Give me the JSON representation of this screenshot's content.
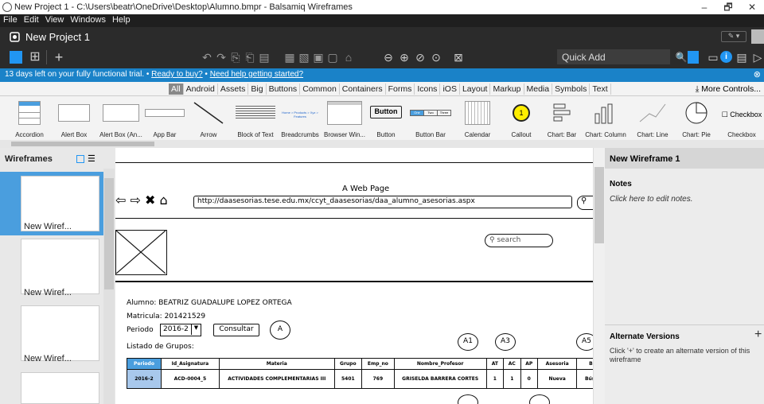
{
  "window": {
    "title": "New Project 1 - C:\\Users\\beatr\\OneDrive\\Desktop\\Alumno.bmpr - Balsamiq Wireframes",
    "min": "–",
    "max": "🗗",
    "close": "✕"
  },
  "menu": [
    "File",
    "Edit",
    "View",
    "Windows",
    "Help"
  ],
  "project": {
    "name": "New Project 1"
  },
  "quick_add": "Quick Add",
  "trial": {
    "text": "13 days left on your fully functional trial.  •  ",
    "buy": "Ready to buy?",
    "sep": "  •  ",
    "help": "Need help getting started?"
  },
  "categories": [
    "All",
    "Android",
    "Assets",
    "Big",
    "Buttons",
    "Common",
    "Containers",
    "Forms",
    "Icons",
    "iOS",
    "Layout",
    "Markup",
    "Media",
    "Symbols",
    "Text"
  ],
  "more_controls": "More Controls...",
  "components": [
    {
      "name": "Accordion",
      "label": "Accordion"
    },
    {
      "name": "alert-box",
      "label": "Alert Box"
    },
    {
      "name": "alert-box-an",
      "label": "Alert Box (An..."
    },
    {
      "name": "app-bar",
      "label": "App Bar"
    },
    {
      "name": "arrow",
      "label": "Arrow"
    },
    {
      "name": "block-of-text",
      "label": "Block of Text"
    },
    {
      "name": "breadcrumbs",
      "label": "Breadcrumbs",
      "sample": "Home > Products > Xyz > Features"
    },
    {
      "name": "browser-window",
      "label": "Browser Win..."
    },
    {
      "name": "button",
      "label": "Button",
      "sample": "Button"
    },
    {
      "name": "button-bar",
      "label": "Button Bar",
      "sample": [
        "One",
        "Two",
        "Three"
      ]
    },
    {
      "name": "calendar",
      "label": "Calendar"
    },
    {
      "name": "callout",
      "label": "Callout",
      "sample": "1"
    },
    {
      "name": "chart-bar",
      "label": "Chart: Bar"
    },
    {
      "name": "chart-column",
      "label": "Chart: Column"
    },
    {
      "name": "chart-line",
      "label": "Chart: Line"
    },
    {
      "name": "chart-pie",
      "label": "Chart: Pie"
    },
    {
      "name": "checkbox",
      "label": "Checkbox",
      "sample": "Checkbox"
    }
  ],
  "sidebar": {
    "title": "Wireframes",
    "thumbs": [
      "New Wiref...",
      "New Wiref...",
      "New Wiref..."
    ]
  },
  "wireframe": {
    "browser_title": "A Web Page",
    "url": "http://daasesorias.tese.edu.mx/ccyt_daasesorias/daa_alumno_asesorias.aspx",
    "search": "search",
    "alumno": "Alumno:  BEATRIZ GUADALUPE LOPEZ ORTEGA",
    "matricula": "Matricula:  201421529",
    "periodo_label": "Periodo",
    "periodo_value": "2016-2",
    "consultar": "Consultar",
    "circle_a": "A",
    "listado": "Listado de Grupos:",
    "circles": [
      "A1",
      "A3",
      "A5"
    ],
    "headers": [
      "Periodo",
      "Id_Asignatura",
      "Materia",
      "Grupo",
      "Emp_no",
      "Nombre_Profesor",
      "AT",
      "AC",
      "AP",
      "Asesoria",
      "Buscar"
    ],
    "row": [
      "2016-2",
      "ACD-0004_5",
      "ACTIVIDADES COMPLEMENTARIAS III",
      "5401",
      "769",
      "GRISELDA BARRERA CORTES",
      "1",
      "1",
      "0",
      "Nueva",
      "Búsqueda"
    ]
  },
  "right": {
    "title": "New Wireframe 1",
    "notes_title": "Notes",
    "notes_hint": "Click here to edit notes.",
    "alt_title": "Alternate Versions",
    "alt_plus": "+",
    "alt_hint": "Click '+' to create an alternate version of this wireframe"
  },
  "colors": {
    "trial_bar": "#1a82c8",
    "accent_blue": "#2196f3",
    "selected_thumb": "#4a9ede"
  }
}
